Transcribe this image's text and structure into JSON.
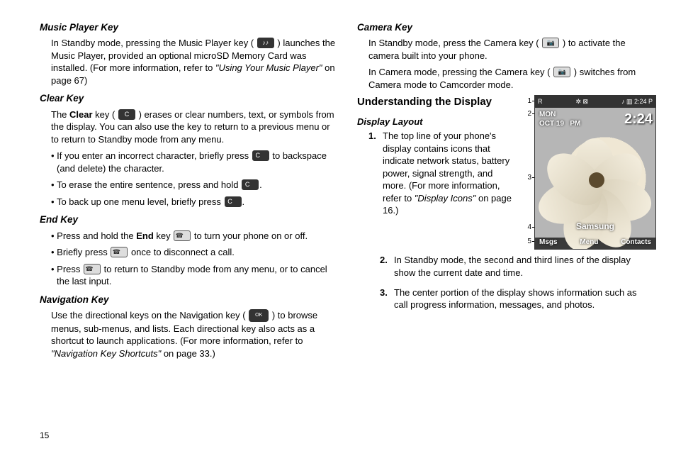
{
  "page_number": "15",
  "left": {
    "music": {
      "h": "Music Player Key",
      "p1a": "In Standby mode, pressing the Music Player key (",
      "icon": "♪♪",
      "p1b": ") launches the Music Player, provided an optional microSD Memory Card was installed. (For more information, refer to ",
      "ref": "\"Using Your Music Player\"",
      "p1c": " on page 67)"
    },
    "clear": {
      "h": "Clear Key",
      "p1a": "The ",
      "bold": "Clear",
      "p1b": " key (",
      "icon": "C",
      "p1c": ") erases or clear numbers, text, or symbols from the display. You can also use the key to return to a previous menu or to return to Standby mode from any menu.",
      "b1a": "If you enter an incorrect character, briefly press ",
      "b1b": " to backspace (and delete) the character.",
      "b2a": "To erase the entire sentence, press and hold ",
      "b3a": "To back up one menu level, briefly press "
    },
    "end": {
      "h": "End Key",
      "b1a": "Press and hold the ",
      "b1bold": "End",
      "b1b": " key ",
      "icon": "☎",
      "b1c": " to turn your phone on or off.",
      "b2a": "Briefly press ",
      "b2b": " once to disconnect a call.",
      "b3a": "Press ",
      "b3b": " to return to Standby mode from any menu, or to cancel the last input."
    },
    "nav": {
      "h": "Navigation Key",
      "p1a": "Use the directional keys on the Navigation key (",
      "icon": "OK",
      "p1b": ") to browse menus, sub-menus, and lists. Each directional key also acts as a shortcut to launch applications. (For more information, refer to ",
      "ref": "\"Navigation Key Shortcuts\"",
      "p1c": " on page 33.)"
    }
  },
  "right": {
    "camera": {
      "h": "Camera Key",
      "p1a": "In Standby mode, press the Camera key (",
      "icon": "📷",
      "p1b": ") to activate the camera built into your phone.",
      "p2a": "In Camera mode, pressing the Camera key (",
      "p2b": ") switches from Camera mode to Camcorder mode."
    },
    "understand": {
      "h": "Understanding the Display",
      "sub": "Display Layout",
      "i1a": "The top line of your phone's display contains icons that indicate network status, battery power, signal strength, and more. (For more information, refer to ",
      "i1ref": "\"Display Icons\"",
      "i1b": " on page 16.)",
      "i2": "In Standby mode, the second and third lines of the display show the current date and time.",
      "i3": "The center portion of the display shows information such as call progress information, messages, and photos."
    }
  },
  "phone": {
    "status_left": "R",
    "status_mid": "✲ ⊠",
    "status_right": "♪ ▥ 2:24 P",
    "day": "MON",
    "date": "OCT 19",
    "ampm": "PM",
    "clock": "2:24",
    "brand": "Samsung",
    "soft_left": "Msgs",
    "soft_mid": "Menu",
    "soft_right": "Contacts",
    "callouts": {
      "c1": "1",
      "c2": "2",
      "c3": "3",
      "c4": "4",
      "c5": "5"
    }
  }
}
